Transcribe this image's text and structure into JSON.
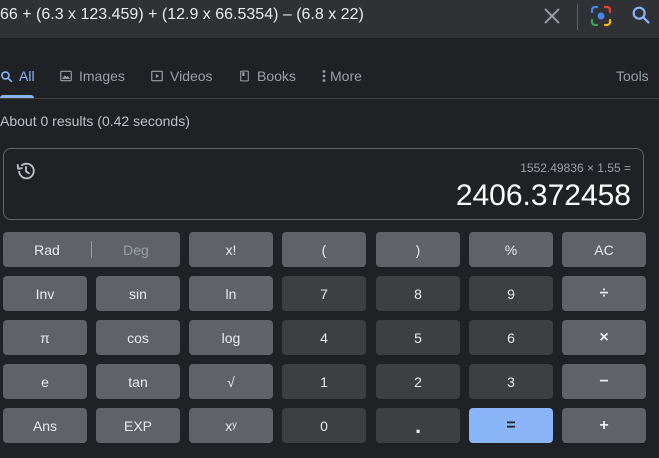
{
  "search": {
    "query": "66 + (6.3 x 123.459) + (12.9 x 66.5354) – (6.8 x 22)"
  },
  "tabs": [
    {
      "label": "All",
      "icon": "search-icon"
    },
    {
      "label": "Images",
      "icon": "image-icon"
    },
    {
      "label": "Videos",
      "icon": "play-icon"
    },
    {
      "label": "Books",
      "icon": "book-icon"
    },
    {
      "label": "More",
      "icon": "more-vert-icon"
    }
  ],
  "tools_label": "Tools",
  "stats": "About 0 results (0.42 seconds)",
  "calculator": {
    "expression": "1552.49836 × 1.55 =",
    "result": "2406.372458",
    "rad_label": "Rad",
    "deg_label": "Deg",
    "keys": {
      "fact": "x!",
      "lparen": "(",
      "rparen": ")",
      "percent": "%",
      "ac": "AC",
      "inv": "Inv",
      "sin": "sin",
      "ln": "ln",
      "seven": "7",
      "eight": "8",
      "nine": "9",
      "divide": "÷",
      "pi": "π",
      "cos": "cos",
      "log": "log",
      "four": "4",
      "five": "5",
      "six": "6",
      "multiply": "×",
      "e": "e",
      "tan": "tan",
      "sqrt": "√",
      "one": "1",
      "two": "2",
      "three": "3",
      "minus": "−",
      "ans": "Ans",
      "exp": "EXP",
      "power": "xʸ",
      "zero": "0",
      "dot": ".",
      "equals": "=",
      "plus": "+"
    }
  },
  "colors": {
    "accent": "#8ab4f8",
    "background": "#202124",
    "function_key": "#5f6368",
    "number_key": "#3c4043"
  }
}
